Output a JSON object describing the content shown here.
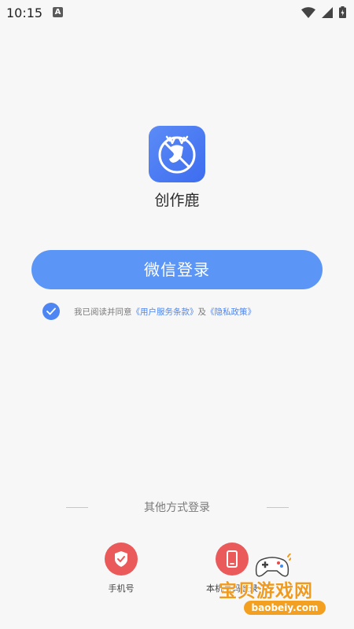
{
  "status_bar": {
    "time": "10:15",
    "badge_letter": "A",
    "icons": [
      "wifi-icon",
      "signal-icon",
      "battery-icon"
    ]
  },
  "app": {
    "icon_name": "deer-logo-icon",
    "name": "创作鹿"
  },
  "login": {
    "wechat_button_label": "微信登录",
    "agreement": {
      "checked": true,
      "prefix": "我已阅读并同意",
      "terms_link": "《用户服务条款》",
      "conjunction": "及",
      "privacy_link": "《隐私政策》"
    }
  },
  "other_methods": {
    "label": "其他方式登录",
    "options": [
      {
        "label": "手机号",
        "icon": "shield-check-icon"
      },
      {
        "label": "本机号码登录",
        "icon": "phone-icon"
      }
    ]
  },
  "watermark": {
    "title": "宝贝游戏网",
    "url": "baobeiy.com"
  },
  "colors": {
    "primary": "#5b96f6",
    "link": "#4d86f2",
    "danger": "#ea5a5a",
    "background": "#f7f7f7",
    "watermark": "#f09a1f"
  }
}
